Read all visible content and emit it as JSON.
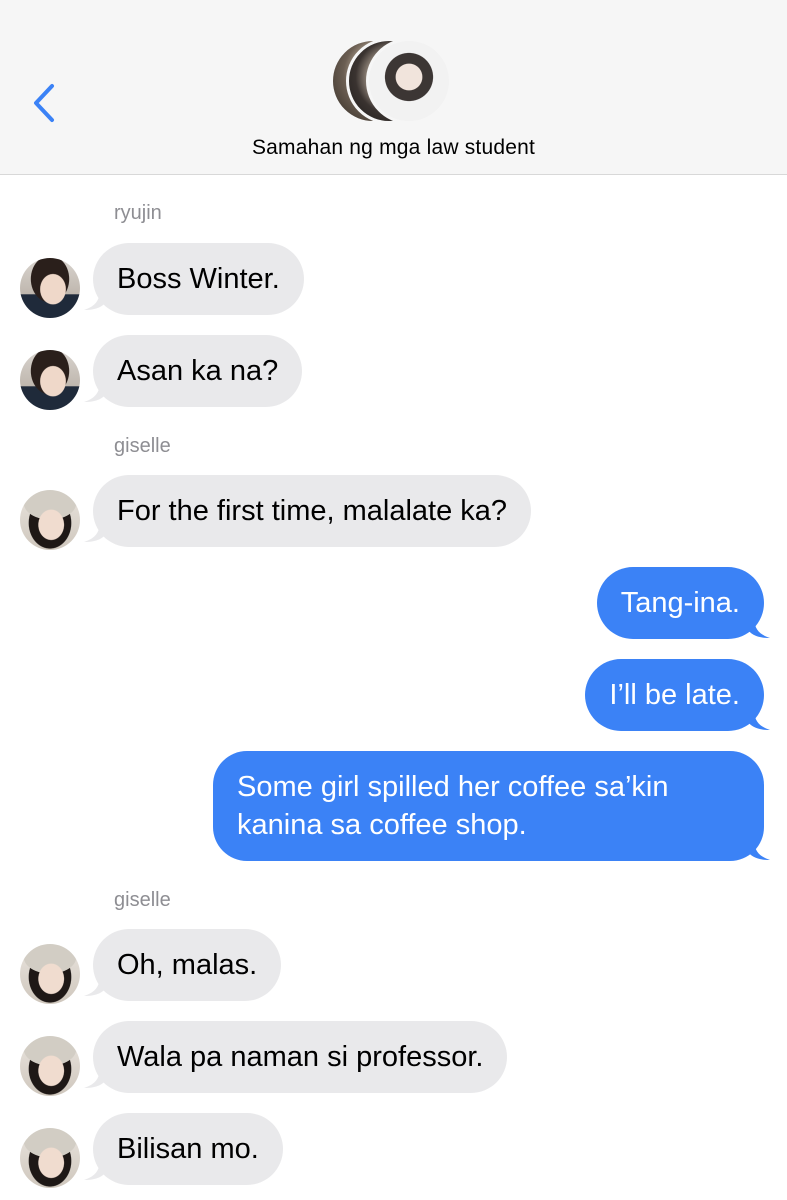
{
  "header": {
    "back_icon": "chevron-left-icon",
    "title": "Samahan ng mga law student",
    "accent_color": "#3b82f6"
  },
  "messages": [
    {
      "type": "sender",
      "name": "ryujin"
    },
    {
      "type": "incoming",
      "sender": "ryujin",
      "text": "Boss Winter."
    },
    {
      "type": "incoming",
      "sender": "ryujin",
      "text": "Asan ka na?"
    },
    {
      "type": "sender",
      "name": "giselle"
    },
    {
      "type": "incoming",
      "sender": "giselle",
      "text": "For the first time, malalate ka?"
    },
    {
      "type": "outgoing",
      "text": "Tang-ina."
    },
    {
      "type": "outgoing",
      "text": "I’ll be late."
    },
    {
      "type": "outgoing",
      "text": "Some girl spilled her coffee sa’kin kanina sa coffee shop."
    },
    {
      "type": "sender",
      "name": "giselle"
    },
    {
      "type": "incoming",
      "sender": "giselle",
      "text": "Oh, malas."
    },
    {
      "type": "incoming",
      "sender": "giselle",
      "text": "Wala pa naman si professor."
    },
    {
      "type": "incoming",
      "sender": "giselle",
      "text": "Bilisan mo."
    }
  ],
  "colors": {
    "incoming_bubble": "#e9e9eb",
    "outgoing_bubble": "#3b82f6",
    "sender_name": "#8e8e93",
    "header_bg": "#f6f6f6"
  }
}
